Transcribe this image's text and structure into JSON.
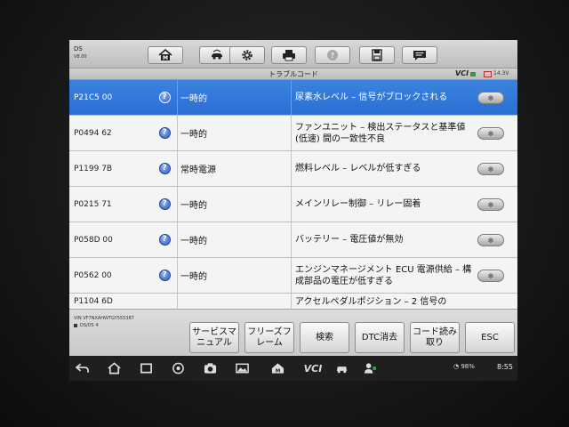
{
  "app": {
    "title": "DS",
    "version": "V8.00"
  },
  "subbar": {
    "title": "トラブルコード",
    "vci_label": "VCI",
    "voltage": "14.3V"
  },
  "toolbar": {
    "buttons": [
      {
        "name": "home-button",
        "icon": "home-m-icon"
      },
      {
        "name": "vehicle-swap-button",
        "icon": "vehicle-swap-icon"
      },
      {
        "name": "settings-button",
        "icon": "gear-icon"
      },
      {
        "name": "print-button",
        "icon": "printer-icon"
      },
      {
        "name": "help-button",
        "icon": "question-icon"
      },
      {
        "name": "save-button",
        "icon": "save-icon"
      },
      {
        "name": "message-button",
        "icon": "chat-icon"
      }
    ]
  },
  "dtc_rows": [
    {
      "code": "P21C5 00",
      "status": "一時的",
      "description": "尿素水レベル – 信号がブロックされる",
      "selected": true
    },
    {
      "code": "P0494 62",
      "status": "一時的",
      "description": "ファンユニット – 検出ステータスと基準値 (低速) 間の一致性不良",
      "selected": false
    },
    {
      "code": "P1199 7B",
      "status": "常時電源",
      "description": "燃料レベル – レベルが低すぎる",
      "selected": false
    },
    {
      "code": "P0215 71",
      "status": "一時的",
      "description": "メインリレー制御 – リレー固着",
      "selected": false
    },
    {
      "code": "P058D 00",
      "status": "一時的",
      "description": "バッテリー – 電圧値が無効",
      "selected": false
    },
    {
      "code": "P0562 00",
      "status": "一時的",
      "description": "エンジンマネージメント ECU 電源供給 – 構成部品の電圧が低すぎる",
      "selected": false
    },
    {
      "code": "P1104 6D",
      "status": "",
      "description": "アクセルペダルポジション – 2 信号の",
      "selected": false
    }
  ],
  "footer": {
    "vin": "VIN VF7NXAHWTGY555387",
    "ds": "DS/DS 4",
    "buttons": [
      {
        "name": "service-manual-button",
        "label": "サービスマニュアル"
      },
      {
        "name": "freeze-frame-button",
        "label": "フリーズフレーム"
      },
      {
        "name": "search-button",
        "label": "検索"
      },
      {
        "name": "clear-dtc-button",
        "label": "DTC消去"
      },
      {
        "name": "read-code-button",
        "label": "コード読み取り"
      },
      {
        "name": "esc-button",
        "label": "ESC"
      }
    ]
  },
  "android": {
    "battery": "98%",
    "time": "8:55"
  },
  "colors": {
    "selected_row": "#2f76d8",
    "topbar": "#c9c9c9",
    "help_icon": "#3f6fe0"
  }
}
